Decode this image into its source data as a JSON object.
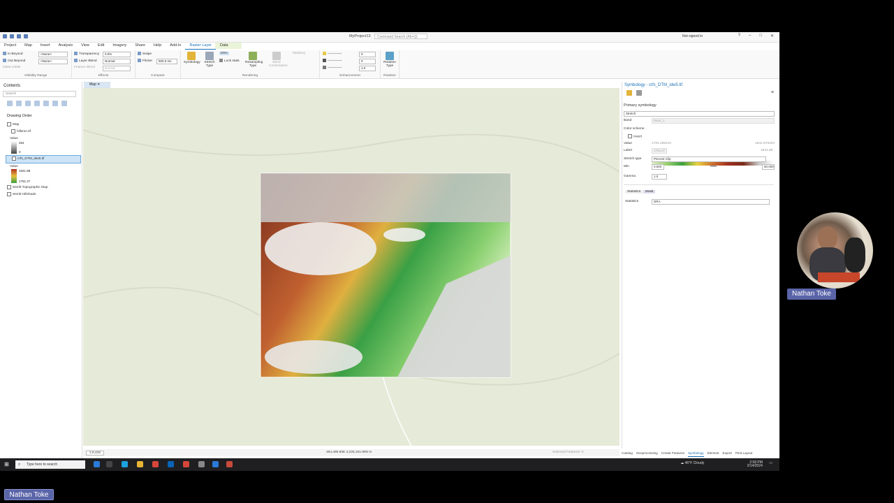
{
  "app": {
    "project_title": "MyProject13",
    "command_search_placeholder": "Command Search (Alt+Q)",
    "signed_in_text": "Not signed in",
    "menu": [
      "Project",
      "Map",
      "Insert",
      "Analysis",
      "View",
      "Edit",
      "Imagery",
      "Share",
      "Help",
      "Add-In",
      "Raster Layer",
      "Data"
    ],
    "active_menu": "Raster Layer"
  },
  "ribbon": {
    "visibility": {
      "in_beyond": "In Beyond",
      "out_beyond": "Out Beyond",
      "clear_limits": "Clear Limits",
      "in_value": "<None>",
      "out_value": "<None>",
      "label": "Visibility Range"
    },
    "effects": {
      "transparency": "Transparency",
      "transparency_value": "0.0%",
      "layer_blend": "Layer Blend",
      "layer_blend_value": "Normal",
      "feature_blend": "Feature Blend",
      "feature_blend_value": "Normal",
      "label": "Effects"
    },
    "compare": {
      "swipe": "Swipe",
      "flicker": "Flicker",
      "flicker_value": "500.0 ms",
      "label": "Compare"
    },
    "rendering": {
      "symbology": "Symbology",
      "stretch_type": "Stretch Type",
      "dra": "DRA",
      "lock_stats": "Lock stats",
      "resampling_type": "Resampling Type",
      "band_combination": "Band Combination",
      "masking": "Masking",
      "label": "Rendering"
    },
    "enhancement": {
      "values": [
        "0",
        "0",
        "1.0"
      ],
      "label": "Enhancement"
    },
    "rotation": {
      "rotation_type": "Rotation Type",
      "label": "Rotation"
    }
  },
  "contents": {
    "title": "Contents",
    "search_placeholder": "Search",
    "drawing_order": "Drawing Order",
    "map_node": "Map",
    "layers": [
      {
        "name": "hillsmn.tif",
        "value_label": "Value",
        "high": "254",
        "low": "0"
      },
      {
        "name": "crfs_DTM_idw5.tif",
        "value_label": "Value",
        "high": "1841.88",
        "low": "1781.27"
      },
      {
        "name": "World Topographic Map"
      },
      {
        "name": "World Hillshade"
      }
    ]
  },
  "map": {
    "tab_label": "Map",
    "scale": "1:8,426",
    "coordinates": "484,485.60E 4,226,101.90N m",
    "selected_features": "Selected Features: 0"
  },
  "symbology": {
    "title": "Symbology - crfs_DTM_idw5.tif",
    "section": "Primary symbology",
    "renderer": "Stretch",
    "band_label": "Band",
    "band_value": "Band_1",
    "color_scheme_label": "Color scheme",
    "invert_label": "Invert",
    "value_label": "Value",
    "value_low": "1781.266210",
    "value_high": "1841.879333",
    "label_label": "Label",
    "label_low": "1781.27",
    "label_high": "1841.88",
    "stretch_type_label": "Stretch type",
    "stretch_type_value": "Percent Clip",
    "min_label": "Min",
    "min_value": "0.500",
    "max_label": "Max",
    "max_value": "50.000",
    "gamma_label": "Gamma",
    "gamma_value": "1.0",
    "tabs": [
      "Statistics",
      "Mask"
    ],
    "statistics_label": "Statistics",
    "statistics_value": "DRA"
  },
  "bottom_tabs": [
    "Catalog",
    "Geoprocessing",
    "Create Features",
    "Symbology",
    "Element",
    "Export",
    "Print Layout"
  ],
  "active_bottom_tab": "Symbology",
  "taskbar": {
    "search_placeholder": "Type here to search",
    "weather": "46°F  Cloudy",
    "time": "2:58 PM",
    "date": "2/14/2024"
  },
  "presenter": {
    "name": "Nathan Toke",
    "name_bottom": "Nathan Toke"
  }
}
